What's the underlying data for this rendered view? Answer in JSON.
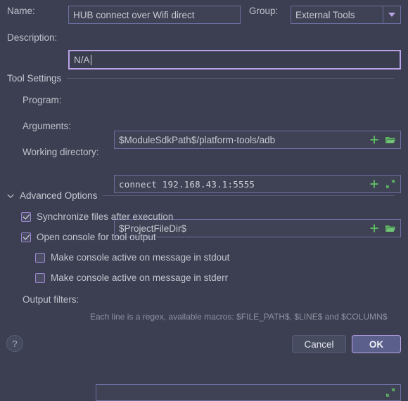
{
  "form": {
    "name_label": "Name:",
    "name_value": "HUB connect over Wifi direct",
    "group_label": "Group:",
    "group_value": "External Tools",
    "group_options": [
      "External Tools"
    ],
    "description_label": "Description:",
    "description_value": "N/A",
    "description_placeholder": ""
  },
  "tool_settings": {
    "title": "Tool Settings",
    "program_label": "Program:",
    "program_value": "$ModuleSdkPath$/platform-tools/adb",
    "arguments_label": "Arguments:",
    "arguments_value": "connect 192.168.43.1:5555",
    "working_dir_label": "Working directory:",
    "working_dir_value": "$ProjectFileDir$",
    "icons": {
      "insert_macro": "plus-icon",
      "browse": "folder-icon",
      "expand": "expand-icon"
    }
  },
  "advanced_options": {
    "title": "Advanced Options",
    "expanded": true,
    "chevron": "chevron-down-icon",
    "checkboxes": [
      {
        "label": "Synchronize files after execution",
        "checked": true,
        "indented": false
      },
      {
        "label": "Open console for tool output",
        "checked": true,
        "indented": false
      },
      {
        "label": "Make console active on message in stdout",
        "checked": false,
        "indented": true
      },
      {
        "label": "Make console active on message in stderr",
        "checked": false,
        "indented": true
      }
    ],
    "output_filters_label": "Output filters:",
    "output_filters_value": "",
    "output_filters_hint": "Each line is a regex, available macros: $FILE_PATH$, $LINE$ and $COLUMN$"
  },
  "footer": {
    "help_label": "?",
    "cancel_label": "Cancel",
    "ok_label": "OK"
  },
  "colors": {
    "background": "#3c3f51",
    "field_bg": "#3f4254",
    "field_border": "#6b6fa0",
    "focus_border": "#b9a2e8",
    "accent_green": "#5cb860",
    "accent_purple": "#b9a2e8",
    "text": "#bdc0c9",
    "hint_text": "#8d91a1",
    "primary_button_bg": "#5b5f8c"
  }
}
